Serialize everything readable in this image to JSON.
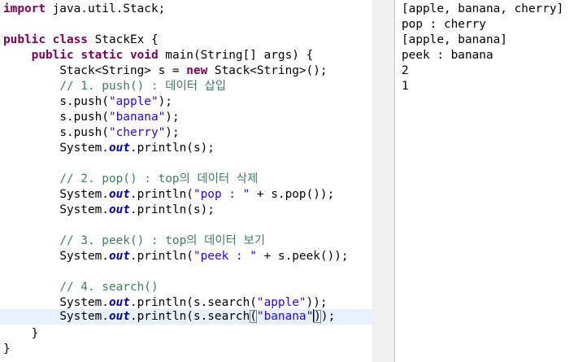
{
  "editor": {
    "import_kw": "import",
    "import_rest": " java.util.Stack;",
    "class_kw1": "public",
    "class_kw2": "class",
    "class_name": " StackEx {",
    "main_kw1": "public",
    "main_kw2": "static",
    "main_kw3": "void",
    "main_rest": " main(String[] args) {",
    "decl_pre": "Stack<String> s = ",
    "decl_kw": "new",
    "decl_post": " Stack<String>();",
    "c1_text": "// 1. push() : 데이터 삽입",
    "push_pre": "s.push(",
    "push_post": ");",
    "push1_arg": "\"apple\"",
    "push2_arg": "\"banana\"",
    "push3_arg": "\"cherry\"",
    "sys": "System.",
    "out": "out",
    "println_s": ".println(s);",
    "c2_text": "// 2. pop() : top의 데이터 삭제",
    "pop_pre": ".println(",
    "pop_str": "\"pop : \"",
    "pop_post": " + s.pop());",
    "c3_text": "// 3. peek() : top의 데이터 보기",
    "peek_pre": ".println(",
    "peek_str": "\"peek : \"",
    "peek_post": " + s.peek());",
    "c4_text": "// 4. search()",
    "search1_pre": ".println(s.search(",
    "search1_arg": "\"apple\"",
    "search1_post": "));",
    "search2_pre": ".println(s.search",
    "search2_open": "(",
    "search2_arg": "\"banana\"",
    "search2_close": ")",
    "search2_post": ");",
    "close_method": "}",
    "close_class": "}"
  },
  "console": {
    "lines": [
      "[apple, banana, cherry]",
      "pop : cherry",
      "[apple, banana]",
      "peek : banana",
      "2",
      "1"
    ]
  }
}
